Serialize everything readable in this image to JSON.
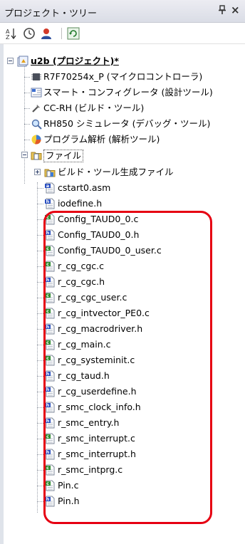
{
  "panel": {
    "title": "プロジェクト・ツリー",
    "pin_glyph": "ᵠ",
    "close_glyph": "×"
  },
  "toolbar": {
    "buttons": [
      {
        "name": "sort-icon"
      },
      {
        "name": "clock-icon"
      },
      {
        "name": "person-icon"
      },
      {
        "name": "refresh-icon"
      }
    ]
  },
  "tree": {
    "project": "u2b (プロジェクト)*",
    "project_children": [
      {
        "label": "R7F70254x_P (マイクロコントローラ)",
        "icon": "microcontroller-icon"
      },
      {
        "label": "スマート・コンフィグレータ (設計ツール)",
        "icon": "smart-configurator-icon"
      },
      {
        "label": "CC-RH (ビルド・ツール)",
        "icon": "build-tool-icon"
      },
      {
        "label": "RH850 シミュレータ (デバッグ・ツール)",
        "icon": "debug-tool-icon"
      },
      {
        "label": "プログラム解析 (解析ツール)",
        "icon": "analysis-tool-icon"
      },
      {
        "label": "ファイル",
        "icon": "folder-icon"
      }
    ],
    "file_children": [
      {
        "label": "ビルド・ツール生成ファイル",
        "type": "folder"
      },
      {
        "label": "cstart0.asm",
        "type": "asm"
      },
      {
        "label": "iodefine.h",
        "type": "h"
      },
      {
        "label": "Config_TAUD0_0.c",
        "type": "c"
      },
      {
        "label": "Config_TAUD0_0.h",
        "type": "h"
      },
      {
        "label": "Config_TAUD0_0_user.c",
        "type": "c"
      },
      {
        "label": "r_cg_cgc.c",
        "type": "c"
      },
      {
        "label": "r_cg_cgc.h",
        "type": "h"
      },
      {
        "label": "r_cg_cgc_user.c",
        "type": "c"
      },
      {
        "label": "r_cg_intvector_PE0.c",
        "type": "c"
      },
      {
        "label": "r_cg_macrodriver.h",
        "type": "h"
      },
      {
        "label": "r_cg_main.c",
        "type": "c"
      },
      {
        "label": "r_cg_systeminit.c",
        "type": "c"
      },
      {
        "label": "r_cg_taud.h",
        "type": "h"
      },
      {
        "label": "r_cg_userdefine.h",
        "type": "h"
      },
      {
        "label": "r_smc_clock_info.h",
        "type": "h"
      },
      {
        "label": "r_smc_entry.h",
        "type": "h"
      },
      {
        "label": "r_smc_interrupt.c",
        "type": "c"
      },
      {
        "label": "r_smc_interrupt.h",
        "type": "h"
      },
      {
        "label": "r_smc_intprg.c",
        "type": "c"
      },
      {
        "label": "Pin.c",
        "type": "c"
      },
      {
        "label": "Pin.h",
        "type": "h"
      }
    ]
  },
  "colors": {
    "highlight": "#e60012",
    "c_file_badge": "#2e8b2e",
    "h_file_badge": "#2a4fbf",
    "asm_file_badge": "#2a4fbf"
  }
}
